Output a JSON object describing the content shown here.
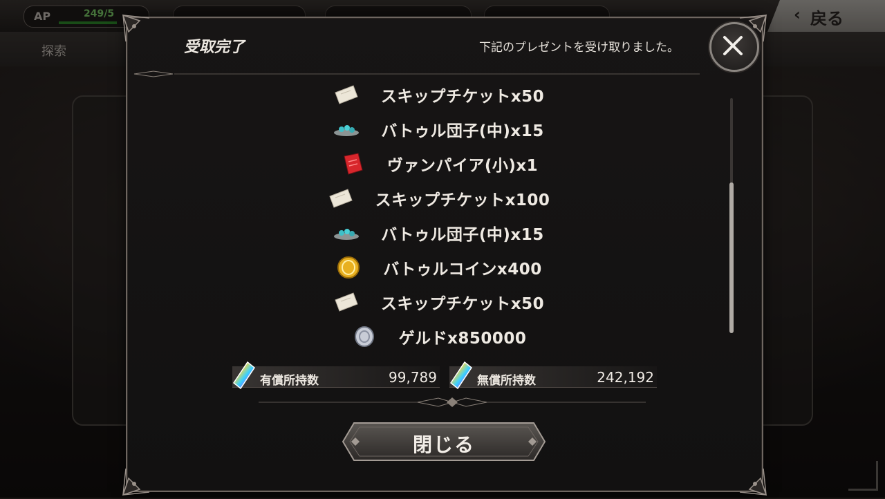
{
  "background": {
    "ap_label": "AP",
    "ap_value": "249/5",
    "back_label": "戻る",
    "explore_label": "探索"
  },
  "dialog": {
    "title": "受取完了",
    "message": "下記のプレゼントを受け取りました。",
    "items": [
      {
        "label": "スキップチケットx50",
        "icon": "ticket-icon"
      },
      {
        "label": "バトゥル団子(中)x15",
        "icon": "dango-icon"
      },
      {
        "label": "ヴァンパイア(小)x1",
        "icon": "vampire-book-icon"
      },
      {
        "label": "スキップチケットx100",
        "icon": "ticket-icon"
      },
      {
        "label": "バトゥル団子(中)x15",
        "icon": "dango-icon"
      },
      {
        "label": "バトゥルコインx400",
        "icon": "coin-icon"
      },
      {
        "label": "スキップチケットx50",
        "icon": "ticket-icon"
      },
      {
        "label": "ゲルドx850000",
        "icon": "geld-coin-icon"
      }
    ],
    "paid_label": "有償所持数",
    "paid_value": "99,789",
    "free_label": "無償所持数",
    "free_value": "242,192",
    "close_button_label": "閉じる"
  },
  "colors": {
    "accent_green": "#7fd06a",
    "ticket": "#e8e2d4",
    "dango": "#3fc0c8",
    "vampire": "#d8262c",
    "coin": "#e8b020",
    "geld": "#c8ccd6"
  }
}
